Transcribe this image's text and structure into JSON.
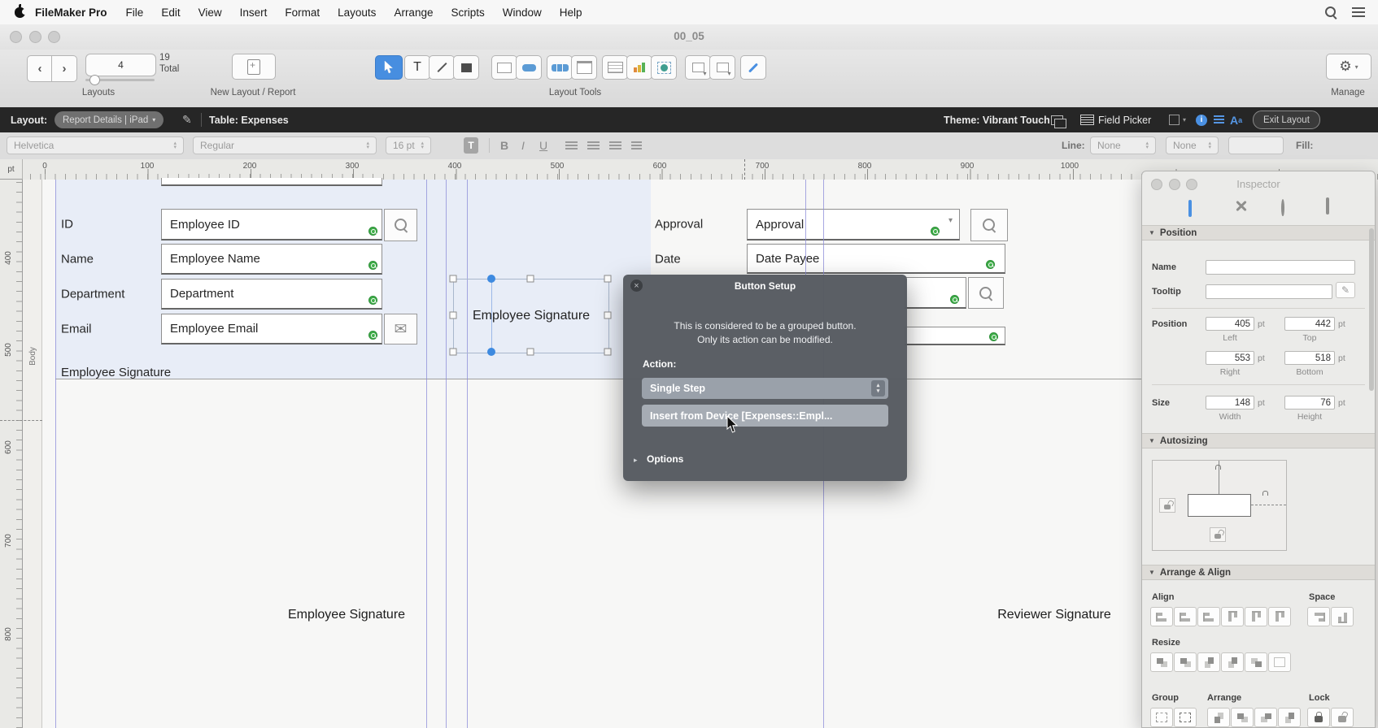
{
  "menubar": {
    "app_name": "FileMaker Pro",
    "items": [
      "File",
      "Edit",
      "View",
      "Insert",
      "Format",
      "Layouts",
      "Arrange",
      "Scripts",
      "Window",
      "Help"
    ]
  },
  "window": {
    "title": "00_05"
  },
  "toolbar": {
    "layout_number": "4",
    "total_count": "19",
    "total_label": "Total",
    "layouts_label": "Layouts",
    "new_layout_label": "New Layout / Report",
    "layout_tools_label": "Layout Tools",
    "manage_label": "Manage"
  },
  "layoutbar": {
    "layout_label": "Layout:",
    "layout_name": "Report Details | iPad",
    "table_label": "Table: Expenses",
    "theme_label": "Theme: Vibrant Touch",
    "field_picker_label": "Field Picker",
    "exit_button": "Exit Layout"
  },
  "formatbar": {
    "font": "Helvetica",
    "style": "Regular",
    "size": "16 pt",
    "bold": "B",
    "italic": "I",
    "underline": "U",
    "line_label": "Line:",
    "line_style": "None",
    "line_width": "None",
    "fill_label": "Fill:"
  },
  "rulers": {
    "unit": "pt",
    "horizontal": [
      "0",
      "100",
      "200",
      "300",
      "400",
      "500",
      "600",
      "700",
      "800",
      "900",
      "1000"
    ],
    "vertical": [
      "400",
      "500",
      "600",
      "700",
      "800"
    ],
    "part_label": "Body"
  },
  "canvas": {
    "left_fields": [
      {
        "label": "ID",
        "value": "Employee ID"
      },
      {
        "label": "Name",
        "value": "Employee Name"
      },
      {
        "label": "Department",
        "value": "Department"
      },
      {
        "label": "Email",
        "value": "Employee Email"
      }
    ],
    "right_fields": [
      {
        "label": "Approval",
        "value": "Approval"
      },
      {
        "label": "Date",
        "value": "Date Payee"
      }
    ],
    "employee_signature_label": "Employee Signature",
    "selected_button_label": "Employee Signature",
    "bottom_left_label": "Employee Signature",
    "bottom_right_label": "Reviewer Signature"
  },
  "dialog": {
    "title": "Button Setup",
    "message_line1": "This is considered to be a grouped button.",
    "message_line2": "Only its action can be modified.",
    "action_label": "Action:",
    "action_value": "Single Step",
    "action_step": "Insert from Device [Expenses::Empl...",
    "options_label": "Options"
  },
  "inspector": {
    "title": "Inspector",
    "sections": {
      "position": "Position",
      "autosizing": "Autosizing",
      "arrange": "Arrange & Align"
    },
    "name_label": "Name",
    "tooltip_label": "Tooltip",
    "position_label": "Position",
    "size_label": "Size",
    "unit": "pt",
    "position": {
      "left": "405",
      "top": "442",
      "right": "553",
      "bottom": "518"
    },
    "size": {
      "width": "148",
      "height": "76"
    },
    "axis_labels": {
      "left": "Left",
      "top": "Top",
      "right": "Right",
      "bottom": "Bottom",
      "width": "Width",
      "height": "Height"
    },
    "align_label": "Align",
    "space_label": "Space",
    "resize_label": "Resize",
    "group_label": "Group",
    "arrange_label": "Arrange",
    "lock_label": "Lock"
  },
  "colors": {
    "accent_blue": "#478ee0",
    "badge_green": "#3fae49",
    "dialog_bg": "#55595f",
    "layoutbar_bg": "#262626"
  }
}
